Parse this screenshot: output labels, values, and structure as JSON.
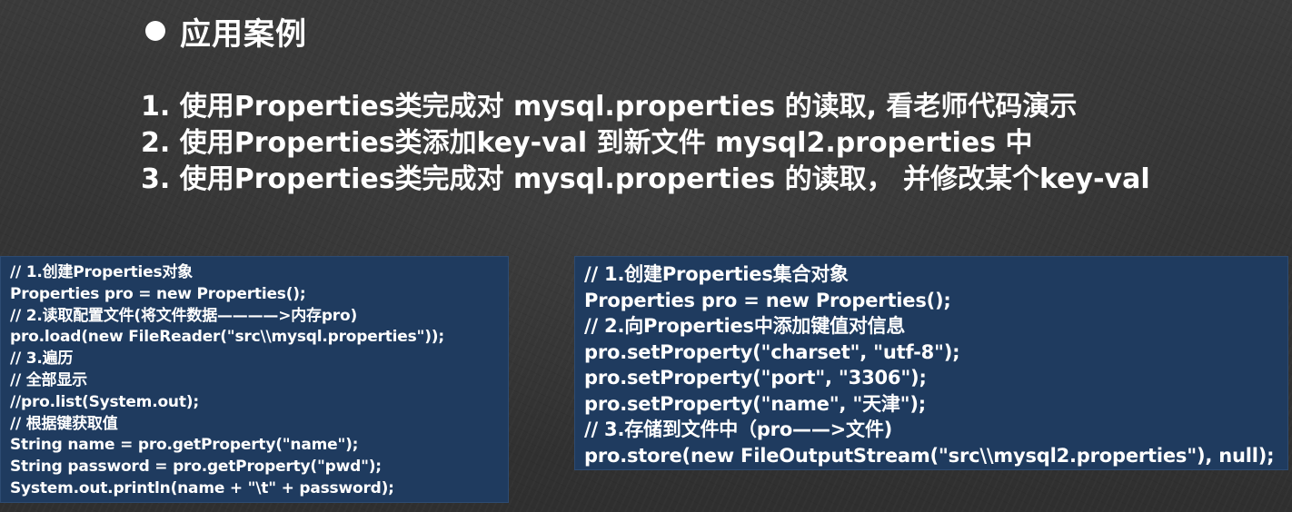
{
  "heading": {
    "title": "应用案例"
  },
  "cases": [
    "1. 使用Properties类完成对 mysql.properties 的读取, 看老师代码演示",
    "2. 使用Properties类添加key-val 到新文件 mysql2.properties 中",
    "3. 使用Properties类完成对 mysql.properties 的读取， 并修改某个key-val"
  ],
  "code_left": [
    "// 1.创建Properties对象",
    "Properties pro = new Properties();",
    "// 2.读取配置文件(将文件数据————>内存pro)",
    "pro.load(new FileReader(\"src\\\\mysql.properties\"));",
    "// 3.遍历",
    "// 全部显示",
    "//pro.list(System.out);",
    "// 根据键获取值",
    "String name = pro.getProperty(\"name\");",
    "String password = pro.getProperty(\"pwd\");",
    "System.out.println(name + \"\\t\" + password);"
  ],
  "code_right": [
    "// 1.创建Properties集合对象",
    "Properties pro = new Properties();",
    "// 2.向Properties中添加键值对信息",
    "pro.setProperty(\"charset\", \"utf-8\");",
    "pro.setProperty(\"port\", \"3306\");",
    "pro.setProperty(\"name\", \"天津\");",
    "// 3.存储到文件中（pro——>文件)",
    "pro.store(new FileOutputStream(\"src\\\\mysql2.properties\"), null);"
  ],
  "colors": {
    "background": "#353535",
    "code_box": "#1f3b5f",
    "text": "#ffffff"
  }
}
